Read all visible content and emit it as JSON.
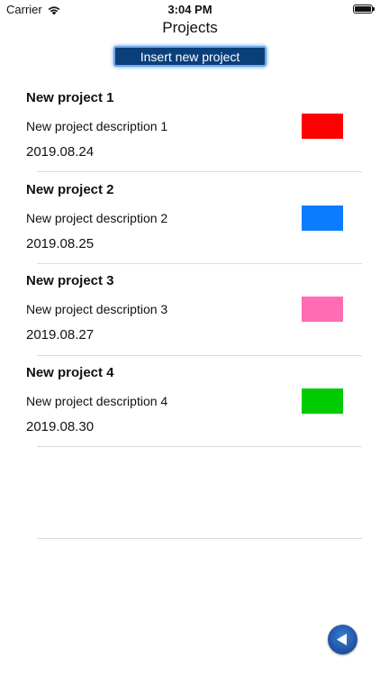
{
  "status_bar": {
    "carrier": "Carrier",
    "time": "3:04 PM"
  },
  "header": {
    "title": "Projects"
  },
  "toolbar": {
    "insert_label": "Insert new project"
  },
  "projects": [
    {
      "name": "New project 1",
      "description": "New project description 1",
      "date": "2019.08.24",
      "color": "#ff0000"
    },
    {
      "name": "New project 2",
      "description": "New project description 2",
      "date": "2019.08.25",
      "color": "#0a7cff"
    },
    {
      "name": "New project 3",
      "description": "New project description 3",
      "date": "2019.08.27",
      "color": "#ff6bb5"
    },
    {
      "name": "New project 4",
      "description": "New project description 4",
      "date": "2019.08.30",
      "color": "#00cc00"
    }
  ],
  "icons": {
    "wifi": "wifi-icon",
    "battery": "battery-icon",
    "back": "back-arrow-icon"
  }
}
